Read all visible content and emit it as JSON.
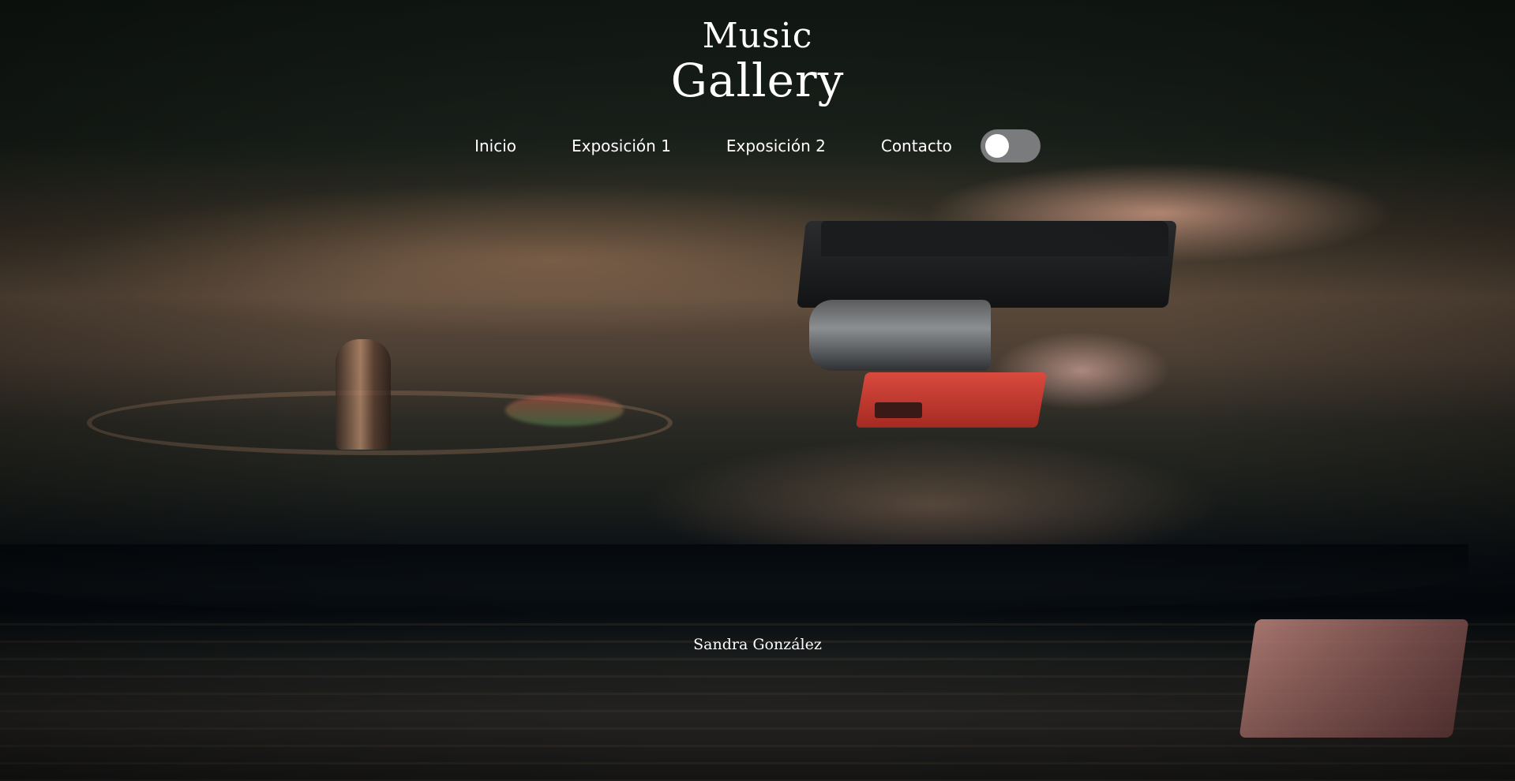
{
  "brand": {
    "line1": "Music",
    "line2": "Gallery"
  },
  "nav": {
    "items": [
      {
        "label": "Inicio"
      },
      {
        "label": "Exposición 1"
      },
      {
        "label": "Exposición 2"
      },
      {
        "label": "Contacto"
      }
    ],
    "theme_toggle": {
      "state": "off"
    }
  },
  "footer": {
    "author": "Sandra González"
  },
  "background": {
    "subject": "turntable-tonearm-photo"
  }
}
